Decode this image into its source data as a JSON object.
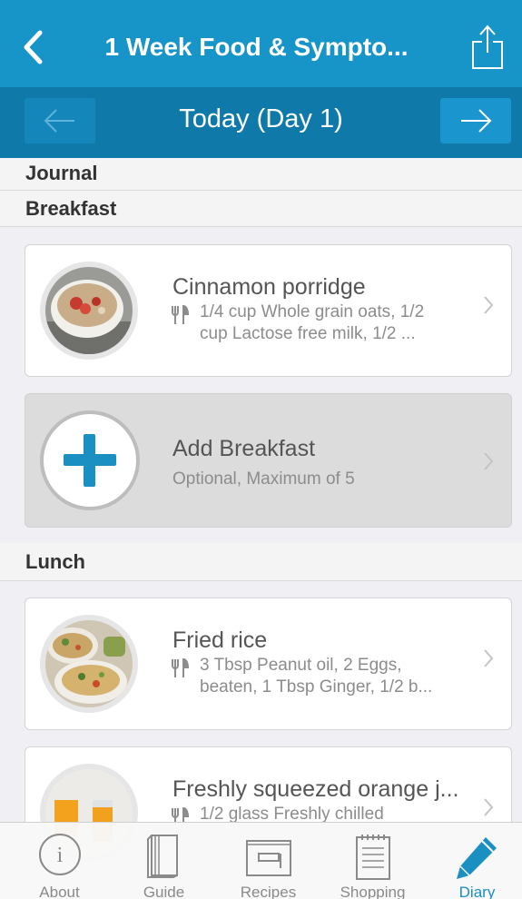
{
  "header": {
    "title": "1 Week Food & Sympto..."
  },
  "daybar": {
    "title": "Today (Day 1)"
  },
  "sections": {
    "journal": "Journal",
    "breakfast": "Breakfast",
    "lunch": "Lunch"
  },
  "breakfast_items": [
    {
      "name": "Cinnamon porridge",
      "line1": "1/4 cup Whole grain oats, 1/2",
      "line2": "cup Lactose free milk, 1/2 ..."
    }
  ],
  "add_breakfast": {
    "title": "Add Breakfast",
    "subtitle": "Optional, Maximum of 5"
  },
  "lunch_items": [
    {
      "name": "Fried rice",
      "line1": "3 Tbsp Peanut oil, 2 Eggs,",
      "line2": "beaten, 1 Tbsp Ginger, 1/2 b..."
    },
    {
      "name": "Freshly squeezed orange j...",
      "line1": "1/2 glass Freshly chilled",
      "line2": ""
    }
  ],
  "tabs": [
    {
      "label": "About",
      "icon": "info-icon"
    },
    {
      "label": "Guide",
      "icon": "book-icon"
    },
    {
      "label": "Recipes",
      "icon": "recipe-box-icon"
    },
    {
      "label": "Shopping",
      "icon": "notepad-icon"
    },
    {
      "label": "Diary",
      "icon": "pencil-icon",
      "active": true
    }
  ],
  "colors": {
    "brand": "#1794c8",
    "brand_dark": "#0f7aa9",
    "accent": "#1a8fc2"
  }
}
